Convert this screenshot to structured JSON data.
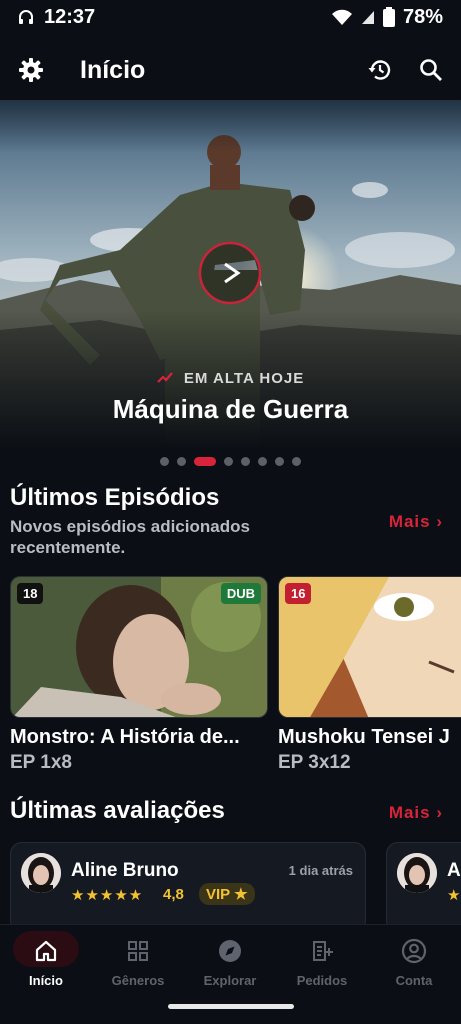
{
  "status": {
    "time": "12:37",
    "battery": "78%"
  },
  "appbar": {
    "title": "Início",
    "icons": [
      "gear-icon",
      "history-icon",
      "search-icon"
    ]
  },
  "hero": {
    "tag": "EM ALTA HOJE",
    "title": "Máquina de Guerra",
    "slides": 8,
    "active_slide": 3
  },
  "latest": {
    "title": "Últimos Episódios",
    "subtitle": "Novos episódios adicionados recentemente.",
    "more": "Mais ›"
  },
  "episodes": [
    {
      "rating": "18",
      "badge": "DUB",
      "title": "Monstro: A História de...",
      "ep": "EP 1x8"
    },
    {
      "rating": "16",
      "title": "Mushoku Tensei J",
      "ep": "EP 3x12"
    }
  ],
  "reviews": {
    "title": "Últimas avaliações",
    "more": "Mais ›",
    "items": [
      {
        "name": "Aline Bruno",
        "time": "1 dia atrás",
        "stars": "★★★★★",
        "score": "4,8",
        "vip": "VIP ★"
      },
      {
        "name": "A",
        "stars": "★"
      }
    ]
  },
  "nav": [
    {
      "label": "Início",
      "icon": "home-icon",
      "active": true
    },
    {
      "label": "Gêneros",
      "icon": "grid-icon"
    },
    {
      "label": "Explorar",
      "icon": "compass-icon"
    },
    {
      "label": "Pedidos",
      "icon": "request-icon"
    },
    {
      "label": "Conta",
      "icon": "account-icon"
    }
  ],
  "colors": {
    "accent": "#d8243a",
    "background": "#0b0e14",
    "vip": "#f2c230"
  }
}
